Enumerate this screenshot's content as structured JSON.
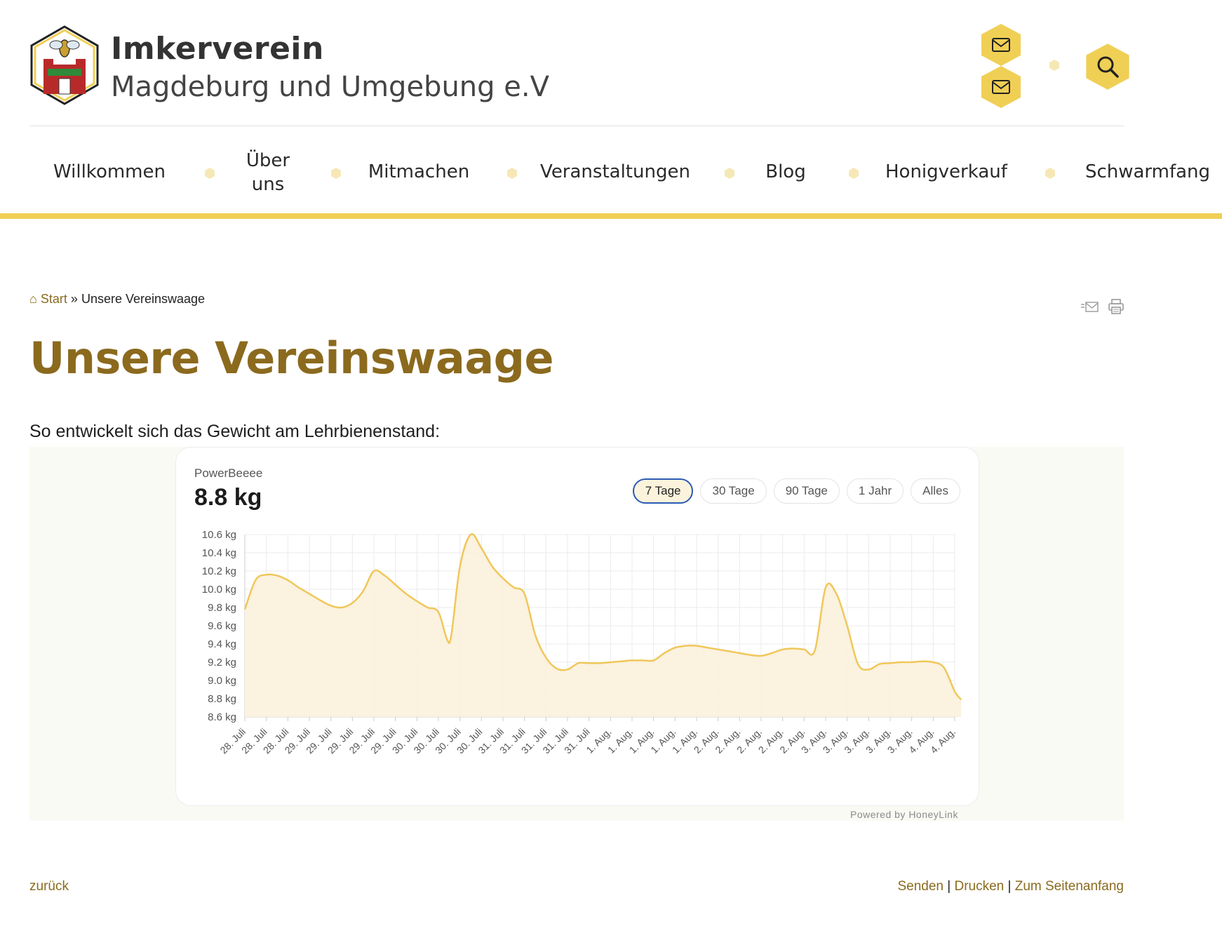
{
  "site": {
    "title_line1": "Imkerverein",
    "title_line2": "Magdeburg und Umgebung e.V"
  },
  "header_icons": [
    "mail-icon",
    "mail-icon",
    "search-icon"
  ],
  "nav": {
    "items": [
      {
        "label": "Willkommen"
      },
      {
        "label": "Über uns"
      },
      {
        "label": "Mitmachen"
      },
      {
        "label": "Veranstaltungen"
      },
      {
        "label": "Blog"
      },
      {
        "label": "Honigverkauf"
      },
      {
        "label": "Schwarmfang"
      }
    ]
  },
  "breadcrumb": {
    "home": "Start",
    "separator": "»",
    "current": "Unsere Vereinswaage"
  },
  "page_title": "Unsere Vereinswaage",
  "intro": "So entwickelt sich das Gewicht am Lehrbienenstand:",
  "widget": {
    "device_name": "PowerBeeee",
    "current_weight": "8.8 kg",
    "ranges": [
      "7 Tage",
      "30 Tage",
      "90 Tage",
      "1 Jahr",
      "Alles"
    ],
    "active_range": "7 Tage",
    "powered_by": "Powered by HoneyLink"
  },
  "chart_data": {
    "type": "area",
    "y_unit": "kg",
    "ylim": [
      8.6,
      10.6
    ],
    "yticks": [
      10.6,
      10.4,
      10.2,
      10.0,
      9.8,
      9.6,
      9.4,
      9.2,
      9.0,
      8.8,
      8.6
    ],
    "ytick_labels": [
      "10.6 kg",
      "10.4 kg",
      "10.2 kg",
      "10.0 kg",
      "9.8 kg",
      "9.6 kg",
      "9.4 kg",
      "9.2 kg",
      "9.0 kg",
      "8.8 kg",
      "8.6 kg"
    ],
    "x_labels": [
      "28. Juli",
      "28. Juli",
      "28. Juli",
      "29. Juli",
      "29. Juli",
      "29. Juli",
      "29. Juli",
      "29. Juli",
      "30. Juli",
      "30. Juli",
      "30. Juli",
      "30. Juli",
      "31. Juli",
      "31. Juli",
      "31. Juli",
      "31. Juli",
      "31. Juli",
      "1. Aug.",
      "1. Aug.",
      "1. Aug.",
      "1. Aug.",
      "1. Aug.",
      "2. Aug.",
      "2. Aug.",
      "2. Aug.",
      "2. Aug.",
      "2. Aug.",
      "3. Aug.",
      "3. Aug.",
      "3. Aug.",
      "3. Aug.",
      "3. Aug.",
      "4. Aug.",
      "4. Aug."
    ],
    "x": [
      0,
      0.5,
      1,
      1.5,
      2,
      2.5,
      3,
      3.5,
      4,
      4.5,
      5,
      5.5,
      6,
      6.5,
      7,
      7.5,
      8,
      8.5,
      9,
      9.4,
      9.6,
      10,
      10.5,
      11,
      11.5,
      12,
      12.5,
      13,
      13.5,
      14,
      14.5,
      15,
      15.5,
      16,
      16.5,
      17,
      17.5,
      18,
      18.5,
      19,
      19.5,
      20,
      20.5,
      21,
      21.5,
      22,
      22.5,
      23,
      23.5,
      24,
      24.5,
      25,
      25.5,
      26,
      26.5,
      27,
      27.5,
      28,
      28.5,
      29,
      29.5,
      30,
      30.5,
      31,
      31.5,
      32,
      32.5,
      33,
      33.3
    ],
    "values": [
      9.78,
      10.1,
      10.16,
      10.15,
      10.1,
      10.02,
      9.95,
      9.88,
      9.82,
      9.8,
      9.85,
      9.98,
      10.2,
      10.15,
      10.05,
      9.95,
      9.87,
      9.8,
      9.75,
      9.45,
      9.5,
      10.25,
      10.6,
      10.45,
      10.25,
      10.12,
      10.02,
      9.95,
      9.5,
      9.25,
      9.13,
      9.12,
      9.19,
      9.19,
      9.19,
      9.2,
      9.21,
      9.22,
      9.22,
      9.22,
      9.3,
      9.36,
      9.38,
      9.38,
      9.36,
      9.34,
      9.32,
      9.3,
      9.28,
      9.27,
      9.3,
      9.34,
      9.35,
      9.34,
      9.33,
      10.02,
      9.95,
      9.6,
      9.18,
      9.12,
      9.18,
      9.19,
      9.2,
      9.2,
      9.21,
      9.2,
      9.14,
      8.88,
      8.79
    ],
    "grid": true,
    "legend": "none"
  },
  "footer": {
    "back": "zurück",
    "send": "Senden",
    "print": "Drucken",
    "top": "Zum Seitenanfang",
    "separator": "|"
  }
}
